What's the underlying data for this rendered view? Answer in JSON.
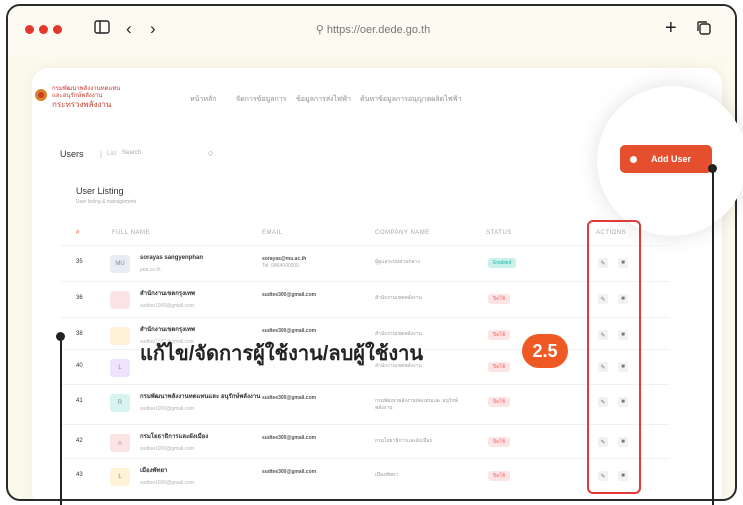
{
  "browser": {
    "url": "https://oer.dede.go.th"
  },
  "header": {
    "logo_line1": "กรมพัฒนาพลังงานทดแทน",
    "logo_line2": "และอนุรักษ์พลังงาน",
    "logo_line3": "กระทรวงพลังงาน",
    "nav_items": [
      "หน้าหลัก",
      "จัดการข้อมูลการ",
      "ข้อมูลการส่งไฟฟ้า",
      "ค้นหาข้อมูลการอนุญาตผลิตไฟฟ้า"
    ]
  },
  "toolbar": {
    "users_label": "Users",
    "separator": "|",
    "list_label": "List",
    "search_placeholder": "Search",
    "add_user_label": "Add User"
  },
  "listing": {
    "title": "User Listing",
    "subtitle": "User listing & management"
  },
  "table": {
    "headers": [
      "#",
      "FULL NAME",
      "EMAIL",
      "COMPANY NAME",
      "STATUS",
      "ACTIONS"
    ],
    "rows": [
      {
        "num": "35",
        "name": "sorayas sangyenphan",
        "sub": "pea.co.th",
        "email": "sorayas@mu.ac.th",
        "email2": "Tel: 0864000000",
        "company": "ผู้ดูแลระบบส่วนกลาง",
        "status": "Enabled",
        "status_kind": "green",
        "avatar_color": "#e7ecf5",
        "avatar_text": "MU"
      },
      {
        "num": "36",
        "name": "สำนักงานเขตกรุงเทพ",
        "sub": "sudtee1000@gmail.com",
        "email": "sudtee300@gmail.com",
        "email2": "",
        "company": "สำนักงานเขตพลังงาน",
        "status": "ปิดใช้",
        "status_kind": "pink",
        "avatar_color": "#fde4e4",
        "avatar_text": ""
      },
      {
        "num": "38",
        "name": "สำนักงานเขตกรุงเทพ",
        "sub": "sudtee1000@gmail.com",
        "email": "sudtee300@gmail.com",
        "email2": "",
        "company": "สำนักงานเขตพลังงาน",
        "status": "ปิดใช้",
        "status_kind": "pink",
        "avatar_color": "#fff2d6",
        "avatar_text": ""
      },
      {
        "num": "40",
        "name": "",
        "sub": "",
        "email": "",
        "email2": "",
        "company": "สำนักงานเขตพลังงาน",
        "status": "ปิดใช้",
        "status_kind": "pink",
        "avatar_color": "#efe3fb",
        "avatar_text": "L"
      },
      {
        "num": "41",
        "name": "กรมพัฒนาพลังงานทดแทนและ อนุรักษ์พลังงาน",
        "sub": "sudtee1000@gmail.com",
        "email": "sudtee300@gmail.com",
        "email2": "",
        "company": "กรมพัฒนาพลังงานทดแทนและ อนุรักษ์พลังงาน",
        "status": "ปิดใช้",
        "status_kind": "pink",
        "avatar_color": "#d7f5f0",
        "avatar_text": "R"
      },
      {
        "num": "42",
        "name": "กรมโยธาธิการและผังเมือง",
        "sub": "sudtee1000@gmail.com",
        "email": "sudtee300@gmail.com",
        "email2": "",
        "company": "กรมโยธาธิการและผังเมือง",
        "status": "ปิดใช้",
        "status_kind": "pink",
        "avatar_color": "#fde4e4",
        "avatar_text": "ก"
      },
      {
        "num": "43",
        "name": "เมืองพัทยา",
        "sub": "sudtee1000@gmail.com",
        "email": "sudtee300@gmail.com",
        "email2": "",
        "company": "เมืองพัทยา",
        "status": "ปิดใช้",
        "status_kind": "pink",
        "avatar_color": "#fff2d6",
        "avatar_text": "L"
      }
    ]
  },
  "overlay": {
    "headline": "แก้ไข/จัดการผู้ใช้งาน/ลบผู้ใช้งาน",
    "step_badge": "2.5"
  },
  "colors": {
    "accent": "#e64f2e",
    "highlight": "#e03a3a",
    "badge": "#ef5a24"
  },
  "icons": {
    "edit": "pencil-icon",
    "delete": "trash-icon"
  }
}
